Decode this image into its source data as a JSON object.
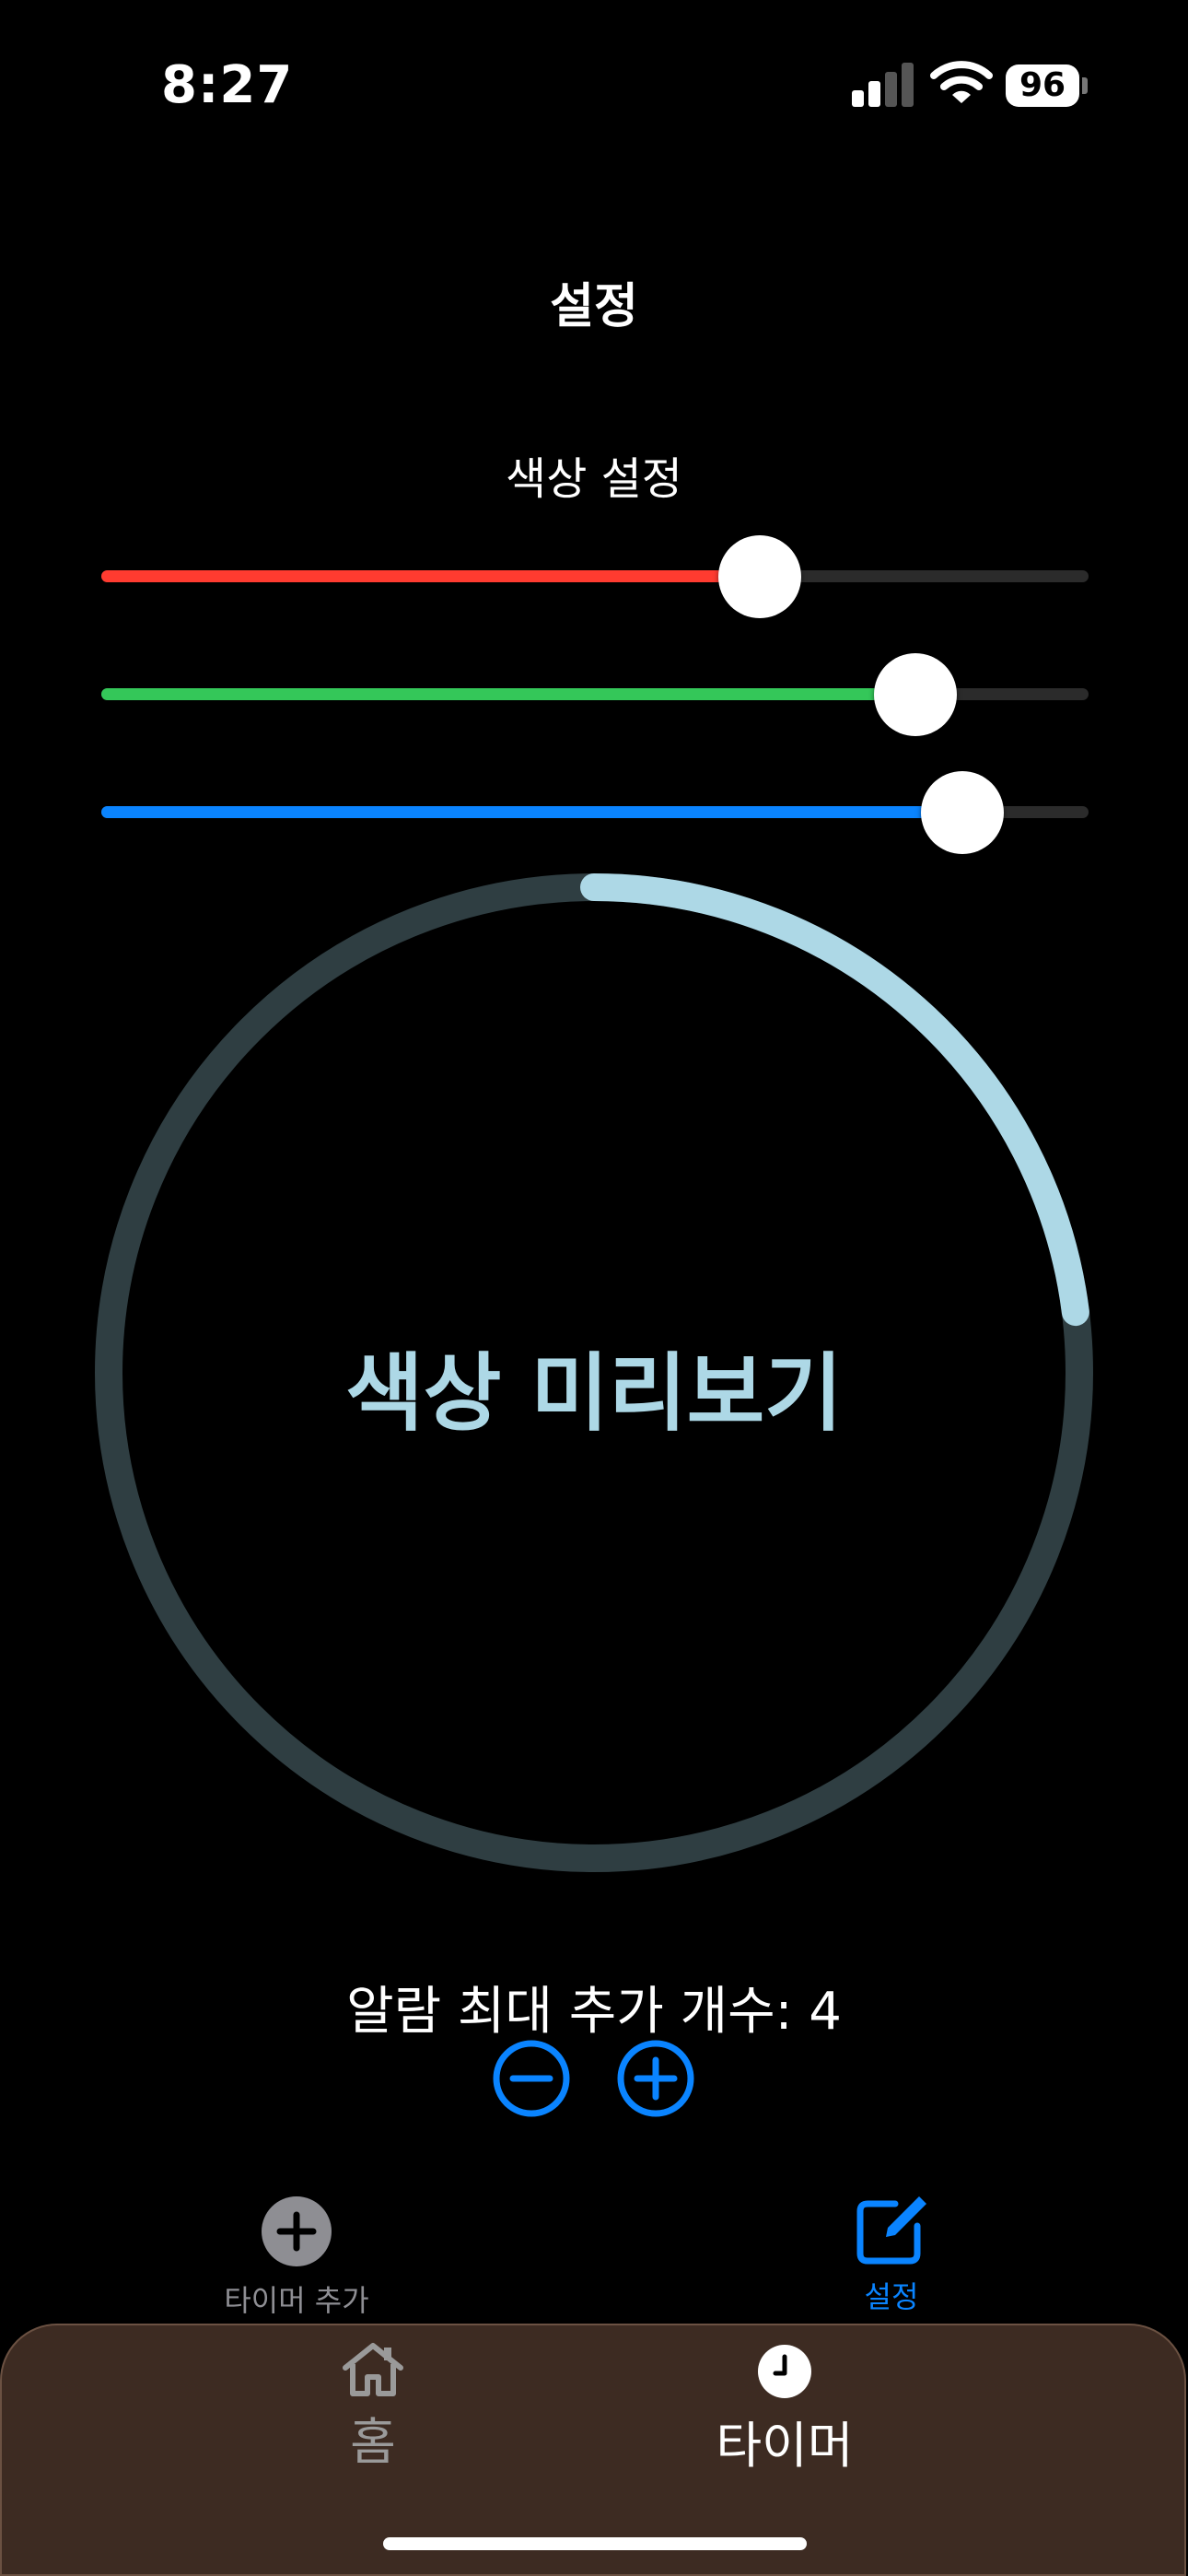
{
  "status_bar": {
    "time": "8:27",
    "battery": "96"
  },
  "header": {
    "title": "설정"
  },
  "color_settings": {
    "label": "색상 설정",
    "sliders": [
      {
        "channel": "red",
        "value_fraction": 0.667,
        "fill_color": "#ff3b30"
      },
      {
        "channel": "green",
        "value_fraction": 0.825,
        "fill_color": "#34c759"
      },
      {
        "channel": "blue",
        "value_fraction": 0.872,
        "fill_color": "#0a84ff"
      }
    ]
  },
  "preview": {
    "label": "색상 미리보기",
    "color": "#add8e6",
    "progress_fraction": 0.23
  },
  "alarm": {
    "label": "알람 최대 추가 개수: 4"
  },
  "inner_tabs": [
    {
      "label": "타이머 추가",
      "icon": "plus-circle-icon",
      "active": false
    },
    {
      "label": "설정",
      "icon": "square-pencil-icon",
      "active": true
    }
  ],
  "bottom_tabs": [
    {
      "label": "홈",
      "icon": "house-icon",
      "active": false
    },
    {
      "label": "타이머",
      "icon": "clock-icon",
      "active": true
    }
  ],
  "colors": {
    "accent": "#0a84ff",
    "dock_background": "#3d2b22"
  }
}
